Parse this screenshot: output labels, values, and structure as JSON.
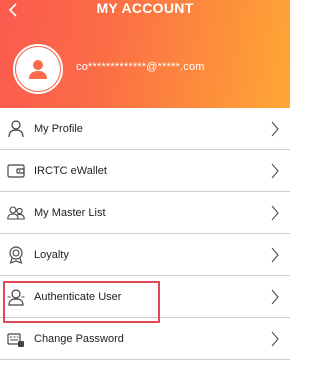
{
  "header": {
    "title": "MY ACCOUNT",
    "email": "co*************@*****.com",
    "gradient_start": "#fb5a4f",
    "gradient_end": "#fea735"
  },
  "menu": {
    "items": [
      {
        "label": "My Profile",
        "icon": "person-icon"
      },
      {
        "label": "IRCTC eWallet",
        "icon": "wallet-icon"
      },
      {
        "label": "My Master List",
        "icon": "users-icon"
      },
      {
        "label": "Loyalty",
        "icon": "badge-icon"
      },
      {
        "label": "Authenticate User",
        "icon": "user-check-icon",
        "highlighted": true
      },
      {
        "label": "Change Password",
        "icon": "keyboard-icon"
      }
    ]
  },
  "colors": {
    "highlight_border": "#e04a57",
    "divider": "#cfcfcf"
  }
}
